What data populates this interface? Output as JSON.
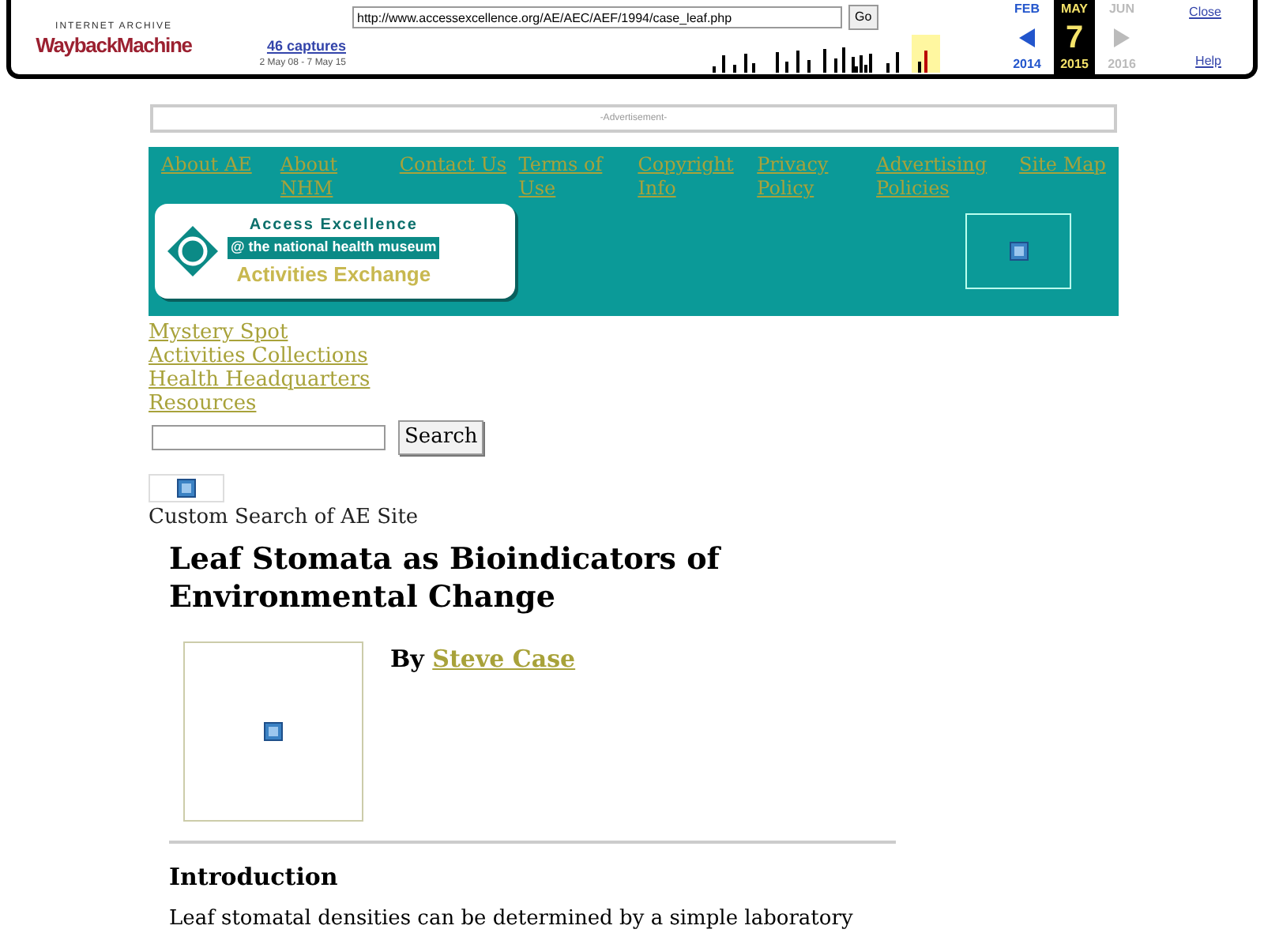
{
  "wayback": {
    "logo_top": "INTERNET ARCHIVE",
    "logo_main": "WaybackMachine",
    "url": "http://www.accessexcellence.org/AE/AEC/AEF/1994/case_leaf.php",
    "go": "Go",
    "captures": "46 captures",
    "range": "2 May 08 - 7 May 15",
    "months": [
      {
        "month": "FEB",
        "year": "2014",
        "selected": false,
        "disabled": false
      },
      {
        "month": "MAY",
        "day": "7",
        "year": "2015",
        "selected": true,
        "disabled": false
      },
      {
        "month": "JUN",
        "year": "2016",
        "selected": false,
        "disabled": true
      }
    ],
    "close": "Close",
    "help": "Help"
  },
  "advertisement": "-Advertisement-",
  "nav": [
    "About AE",
    "About NHM",
    "Contact Us",
    "Terms of Use",
    "Copyright Info",
    "Privacy Policy",
    "Advertising Policies",
    "Site Map"
  ],
  "banner": {
    "line1": "Access Excellence",
    "line2": "@ the national health museum",
    "line3": "Activities Exchange"
  },
  "links": [
    "Mystery Spot",
    "Activities Collections",
    "Health Headquarters",
    "Resources"
  ],
  "search": {
    "button": "Search"
  },
  "custom_search": "Custom Search of AE Site",
  "article": {
    "title": "Leaf Stomata as Bioindicators of Environmental Change",
    "by": "By",
    "author": "Steve Case",
    "section": "Introduction",
    "text": "Leaf stomatal densities can be determined by a simple laboratory"
  }
}
